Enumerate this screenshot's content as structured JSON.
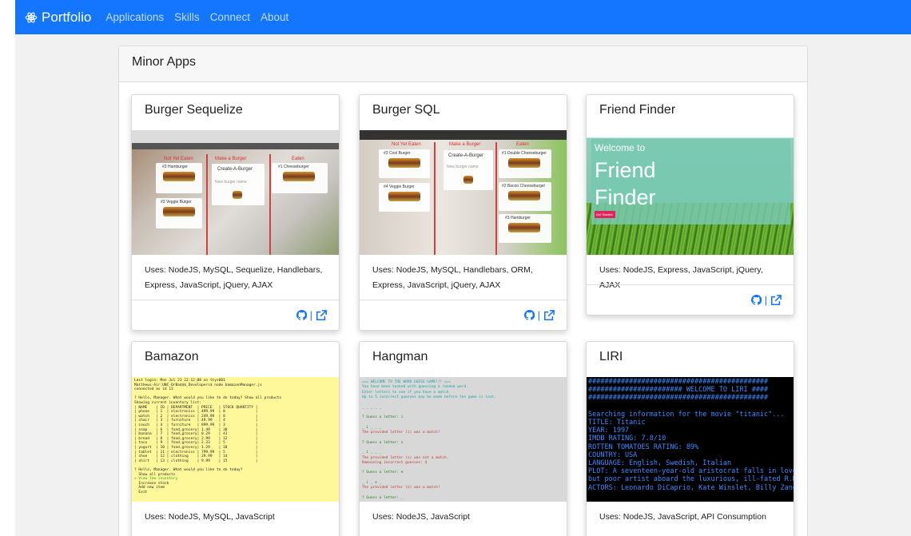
{
  "navbar": {
    "brand": "Portfolio",
    "brand_icon": "react-atom-icon",
    "links": [
      "Applications",
      "Skills",
      "Connect",
      "About"
    ]
  },
  "section": {
    "title": "Minor Apps"
  },
  "cards": [
    {
      "title": "Burger Sequelize",
      "uses": "Uses: NodeJS, MySQL, Sequelize, Handlebars, Express, JavaScript, jQuery, AJAX",
      "thumb": {
        "left_title": "Not Yet Eaten",
        "center_title": "Make a Burger",
        "right_title": "Eaten",
        "form_title": "Create-A-Burger",
        "placeholder": "New burger name",
        "items": [
          "#3 Hamburger",
          "#1 Cheeseburger",
          "#3 Veggie Burger"
        ]
      }
    },
    {
      "title": "Burger SQL",
      "uses": "Uses: NodeJS, MySQL, Handlebars, ORM, Express, JavaScript, jQuery, AJAX",
      "thumb": {
        "left_title": "Not Yet Eaten",
        "center_title": "Make a Burger",
        "right_title": "Eaten",
        "form_title": "Create-A-Burger",
        "placeholder": "New burger name",
        "items": [
          "#3 Cool Burger",
          "#1 Double Cheeseburger",
          "#4 Veggie Burger",
          "#2 Bacon Cheeseburger",
          "#3 Hamburger"
        ]
      }
    },
    {
      "title": "Friend Finder",
      "uses": "Uses: NodeJS, Express, JavaScript, jQuery, AJAX",
      "thumb": {
        "welcome": "Welcome to",
        "title_line1": "Friend",
        "title_line2": "Finder",
        "button": "Get Started"
      }
    },
    {
      "title": "Bamazon",
      "uses": "Uses: NodeJS, MySQL, JavaScript",
      "thumb": {
        "lines": [
          "Last login: Mon Jul 23 22:12:08 on ttys001",
          "Matthews-Air:UNC-OrBa$$$_Developers$ node bamazonManager.js",
          "connected as id 13",
          "",
          "? Hello, Manager. What would you like to do today? Show all products",
          "Showing current inventory list:",
          "| NAME    | ID | DEPARTMENT  | PRICE   | STOCK QUANTITY |",
          "| phone   | 1  | electronics | 499.99  | 8              |",
          "| watch   | 2  | electronics | 249.99  | 8              |",
          "| chair   | 3  | furniture   | 49.99   | 4              |",
          "| couch   | 4  | furniture   | 899.99  | 3              |",
          "| soap    | 6  | food,grocery| 1.49    | 30             |",
          "| banana  | 7  | food,grocery| 0.29    | 41             |",
          "| bread   | 8  | food,grocery| 2.99    | 12             |",
          "| taco    | 9  | food,grocery| 2.33    | 5              |",
          "| yogurt  | 10 | food,grocery| 1.29    | 18             |",
          "| tablet  | 11 | electronics | 799.99  | 5              |",
          "| shoe    | 12 | clothing    | 29.99   | 14             |",
          "| shirt   | 13 | clothing    | 9.99    | 15             |",
          "",
          "? Hello, Manager. What would you like to do today?",
          "  Show all products",
          "> View low inventory",
          "  Increase stock",
          "  Add new item",
          "  Exit"
        ]
      }
    },
    {
      "title": "Hangman",
      "uses": "Uses: NodeJS, JavaScript",
      "thumb": {
        "lines": [
          "=== WELCOME TO THE WORD GUESS GAME!!! ===",
          "You have been tasked with guessing a random word.",
          "Enter letters to see if you have a match.",
          "Up to 5 incorrect guesses may be made before the game is lost.",
          "",
          "_ _ _ _ _",
          "",
          "? Guess a letter: i",
          "",
          "_ i _ _ _",
          "The provided letter (i) was a match!",
          "",
          "? Guess a letter: s",
          "",
          "_ i _ _ _",
          "The provided letter (s) was not a match.",
          "Remaining incorrect guesses: 4",
          "",
          "? Guess a letter: e",
          "",
          "_ i _ e _",
          "The provided letter (e) was a match!",
          "",
          "? Guess a letter: _"
        ]
      }
    },
    {
      "title": "LIRI",
      "uses": "Uses: NodeJS, JavaScript, API Consumption",
      "thumb": {
        "lines": [
          "############################################",
          "####################### WELCOME TO LIRI ####",
          "############################################",
          "",
          "Searching information for the movie \"titanic\"...",
          "TITLE: Titanic",
          "YEAR: 1997",
          "IMDB RATING: 7.8/10",
          "ROTTEN TOMATOES RATING: 89%",
          "COUNTRY: USA",
          "LANGUAGE: English, Swedish, Italian",
          "PLOT: A seventeen-year-old aristocrat falls in love w",
          "but poor artist aboard the luxurious, ill-fated R.M.S",
          "ACTORS: Leonardo DiCaprio, Kate Winslet, Billy Zane,"
        ]
      }
    }
  ],
  "footer_icons": [
    "github-icon",
    "external-link-icon"
  ],
  "footer_separator": "|",
  "colors": {
    "navbar": "#1476ff",
    "link": "#1476ff",
    "background": "#f1f1f1"
  }
}
